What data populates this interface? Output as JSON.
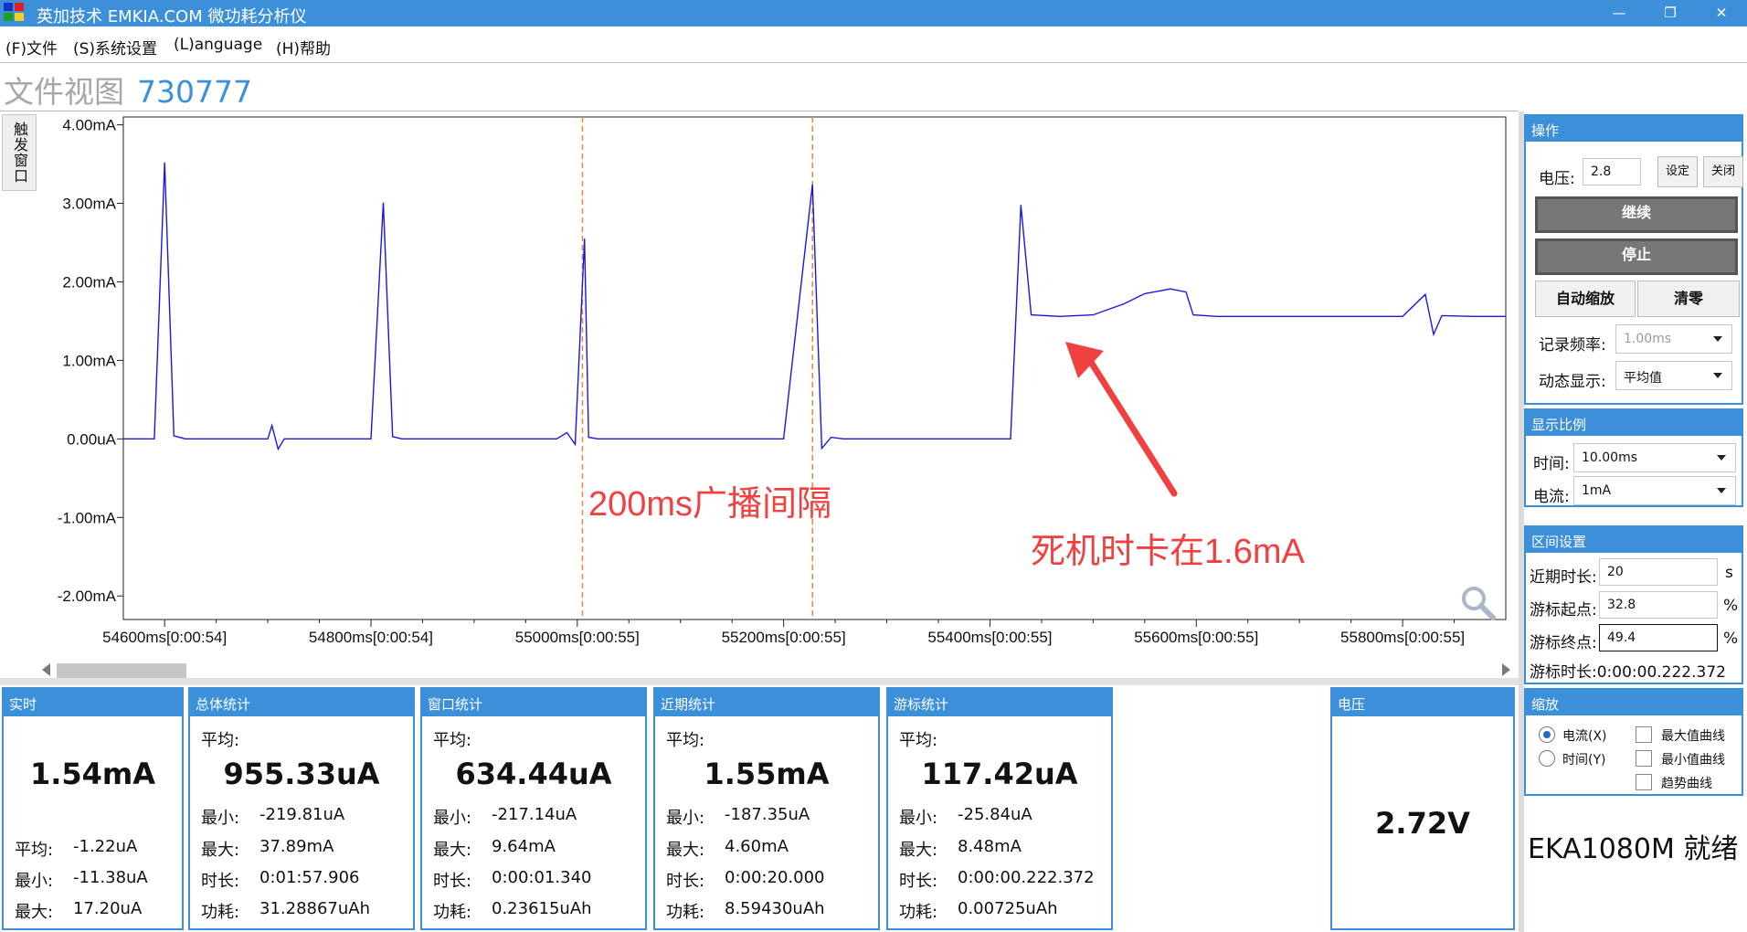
{
  "window": {
    "title": "英加技术 EMKIA.COM 微功耗分析仪",
    "controls": {
      "minimize": "—",
      "maximize": "❐",
      "close": "✕"
    }
  },
  "menu": [
    "(F)文件",
    "(S)系统设置",
    "(L)anguage",
    "(H)帮助"
  ],
  "view": {
    "title": "文件视图",
    "id": "730777"
  },
  "trigger_tab": "触发窗口",
  "colors": {
    "accent": "#3c8fd9",
    "trace": "#1818e0",
    "marker": "#e8883a",
    "annotation": "#f04040"
  },
  "chart_data": {
    "type": "line",
    "title": "",
    "xlabel": "",
    "ylabel": "",
    "xlim": [
      54560,
      55900
    ],
    "ylim": [
      -2.3,
      4.1
    ],
    "ytick_values": [
      4.0,
      3.0,
      2.0,
      1.0,
      0.0,
      -1.0,
      -2.0
    ],
    "ytick_labels": [
      "4.00mA",
      "3.00mA",
      "2.00mA",
      "1.00mA",
      "0.00uA",
      "-1.00mA",
      "-2.00mA"
    ],
    "xtick_values": [
      54600,
      54800,
      55000,
      55200,
      55400,
      55600,
      55800
    ],
    "xtick_labels": [
      "54600ms[0:00:54]",
      "54800ms[0:00:54]",
      "55000ms[0:00:55]",
      "55200ms[0:00:55]",
      "55400ms[0:00:55]",
      "55600ms[0:00:55]",
      "55800ms[0:00:55]"
    ],
    "markers_x": [
      55005,
      55228
    ],
    "series": [
      {
        "x": [
          54560,
          54580,
          54590,
          54600,
          54609,
          54620,
          54700,
          54704,
          54710,
          54716,
          54730,
          54800,
          54812,
          54821,
          54830,
          54900,
          54980,
          54990,
          54998,
          55007,
          55011,
          55020,
          55100,
          55200,
          55228,
          55237,
          55246,
          55258,
          55300,
          55420,
          55430,
          55440,
          55468,
          55500,
          55530,
          55550,
          55575,
          55590,
          55597,
          55620,
          55700,
          55800,
          55822,
          55830,
          55838,
          55870,
          55900
        ],
        "y": [
          0.0,
          0.0,
          0.0,
          3.52,
          0.04,
          0.0,
          0.0,
          0.17,
          -0.13,
          0.0,
          0.0,
          0.0,
          3.01,
          0.03,
          0.0,
          0.0,
          0.0,
          0.08,
          -0.07,
          2.55,
          0.02,
          0.0,
          0.0,
          0.0,
          3.24,
          -0.12,
          0.02,
          0.0,
          0.0,
          0.0,
          2.98,
          1.58,
          1.56,
          1.58,
          1.72,
          1.85,
          1.91,
          1.87,
          1.58,
          1.56,
          1.56,
          1.56,
          1.84,
          1.33,
          1.57,
          1.56,
          1.56
        ]
      }
    ],
    "annotations": [
      {
        "text": "200ms广播间隔"
      },
      {
        "text": "死机时卡在1.6mA"
      }
    ]
  },
  "stats": [
    {
      "header": "实时",
      "avg_label": "",
      "main": "1.54mA",
      "rows": [
        {
          "k": "平均:",
          "v": "-1.22uA"
        },
        {
          "k": "最小:",
          "v": "-11.38uA"
        },
        {
          "k": "最大:",
          "v": "17.20uA"
        }
      ]
    },
    {
      "header": "总体统计",
      "avg_label": "平均:",
      "main": "955.33uA",
      "rows": [
        {
          "k": "最小:",
          "v": "-219.81uA"
        },
        {
          "k": "最大:",
          "v": "37.89mA"
        },
        {
          "k": "时长:",
          "v": "0:01:57.906"
        },
        {
          "k": "功耗:",
          "v": "31.28867uAh"
        }
      ]
    },
    {
      "header": "窗口统计",
      "avg_label": "平均:",
      "main": "634.44uA",
      "rows": [
        {
          "k": "最小:",
          "v": "-217.14uA"
        },
        {
          "k": "最大:",
          "v": "9.64mA"
        },
        {
          "k": "时长:",
          "v": "0:00:01.340"
        },
        {
          "k": "功耗:",
          "v": "0.23615uAh"
        }
      ]
    },
    {
      "header": "近期统计",
      "avg_label": "平均:",
      "main": "1.55mA",
      "rows": [
        {
          "k": "最小:",
          "v": "-187.35uA"
        },
        {
          "k": "最大:",
          "v": "4.60mA"
        },
        {
          "k": "时长:",
          "v": "0:00:20.000"
        },
        {
          "k": "功耗:",
          "v": "8.59430uAh"
        }
      ]
    },
    {
      "header": "游标统计",
      "avg_label": "平均:",
      "main": "117.42uA",
      "rows": [
        {
          "k": "最小:",
          "v": "-25.84uA"
        },
        {
          "k": "最大:",
          "v": "8.48mA"
        },
        {
          "k": "时长:",
          "v": "0:00:00.222.372"
        },
        {
          "k": "功耗:",
          "v": "0.00725uAh"
        }
      ]
    }
  ],
  "voltage_box": {
    "header": "电压",
    "value": "2.72V"
  },
  "operation": {
    "header": "操作",
    "voltage_label": "电压:",
    "voltage_value": "2.8",
    "set_button": "设定",
    "close_button": "关闭",
    "continue_button": "继续",
    "stop_button": "停止",
    "auto_zoom_button": "自动缩放",
    "clear_button": "清零",
    "record_rate_label": "记录频率:",
    "record_rate_value": "1.00ms",
    "dynamic_label": "动态显示:",
    "dynamic_value": "平均值"
  },
  "display_scale": {
    "header": "显示比例",
    "time_label": "时间:",
    "time_value": "10.00ms",
    "current_label": "电流:",
    "current_value": "1mA"
  },
  "range": {
    "header": "区间设置",
    "recent_label": "近期时长:",
    "recent_value": "20",
    "recent_unit": "s",
    "start_label": "游标起点:",
    "start_value": "32.8",
    "start_unit": "%",
    "end_label": "游标终点:",
    "end_value": "49.4",
    "end_unit": "%",
    "duration_text": "游标时长:0:00:00.222.372"
  },
  "zoom": {
    "header": "缩放",
    "radio_current": "电流(X)",
    "radio_time": "时间(Y)",
    "radio_selected": "电流(X)",
    "check_max": "最大值曲线",
    "check_min": "最小值曲线",
    "check_trend": "趋势曲线"
  },
  "status": "EKA1080M  就绪"
}
